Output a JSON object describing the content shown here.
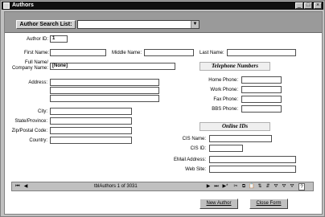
{
  "window": {
    "title": "Authors",
    "controls": [
      "_",
      "□",
      "×"
    ]
  },
  "header": {
    "search_label": "Author Search List:",
    "search_value": "",
    "dropdown_glyph": "▼"
  },
  "fields": {
    "author_id": {
      "label": "Author ID:",
      "value": "1"
    },
    "first_name": {
      "label": "First Name:",
      "value": ""
    },
    "middle_name": {
      "label": "Middle Name:",
      "value": ""
    },
    "last_name": {
      "label": "Last Name:",
      "value": ""
    },
    "full_name": {
      "label_line1": "Full Name/",
      "label_line2": "Company Name:",
      "value": "[None]"
    },
    "address": {
      "label": "Address:",
      "values": [
        "",
        "",
        ""
      ]
    },
    "city": {
      "label": "City:",
      "value": ""
    },
    "state": {
      "label": "State/Province:",
      "value": ""
    },
    "zip": {
      "label": "Zip/Postal Code:",
      "value": ""
    },
    "country": {
      "label": "Country:",
      "value": ""
    }
  },
  "telephone": {
    "heading": "Telephone Numbers",
    "home": {
      "label": "Home Phone:",
      "value": ""
    },
    "work": {
      "label": "Work Phone:",
      "value": ""
    },
    "fax": {
      "label": "Fax Phone:",
      "value": ""
    },
    "bbs": {
      "label": "BBS Phone:",
      "value": ""
    }
  },
  "online": {
    "heading": "Online IDs",
    "cis_name": {
      "label": "CIS Name:",
      "value": ""
    },
    "cis_id": {
      "label": "CIS ID:",
      "value": ""
    },
    "email": {
      "label": "EMail Address:",
      "value": ""
    },
    "web": {
      "label": "Web Site:",
      "value": ""
    }
  },
  "navigation": {
    "first": "⏮",
    "prev": "◀",
    "record_text": "tblAuthors 1 of 3031",
    "next": "▶",
    "last": "⏭",
    "new_record": "▶*",
    "tools": [
      "✂",
      "⧉",
      "📋",
      "⇅",
      "⇵",
      "⛛",
      "⛛",
      "⛛",
      "?"
    ]
  },
  "buttons": {
    "new_author": "New Author",
    "close_form": "Close Form"
  }
}
